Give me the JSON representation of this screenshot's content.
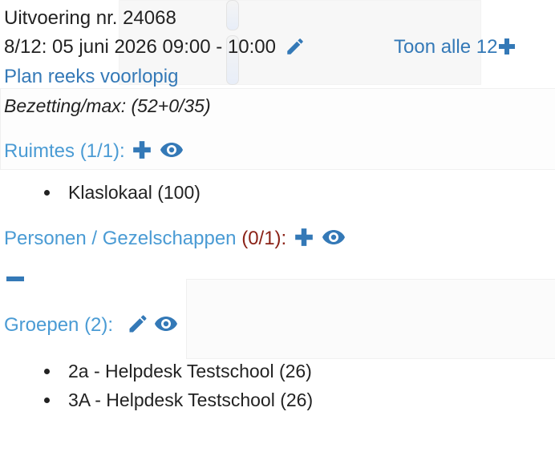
{
  "header": {
    "title": "Uitvoering nr. 24068",
    "datetime": "8/12: 05 juni 2026 09:00 - 10:00",
    "show_all": "Toon alle 12",
    "plan_link": "Plan reeks voorlopig",
    "occupancy": "Bezetting/max: (52+0/35)"
  },
  "rooms": {
    "title": "Ruimtes (1/1):",
    "items": [
      "Klaslokaal (100)"
    ]
  },
  "persons": {
    "title": "Personen / Gezelschappen",
    "count": "(0/1):"
  },
  "groups": {
    "title": "Groepen (2):",
    "items": [
      "2a - Helpdesk Testschool (26)",
      "3A - Helpdesk Testschool (26)"
    ]
  },
  "colors": {
    "link": "#3479b7",
    "section": "#4a9bd4",
    "count_red": "#8b2318"
  },
  "icons": [
    "pencil-icon",
    "plus-icon",
    "eye-icon",
    "minus-icon"
  ]
}
